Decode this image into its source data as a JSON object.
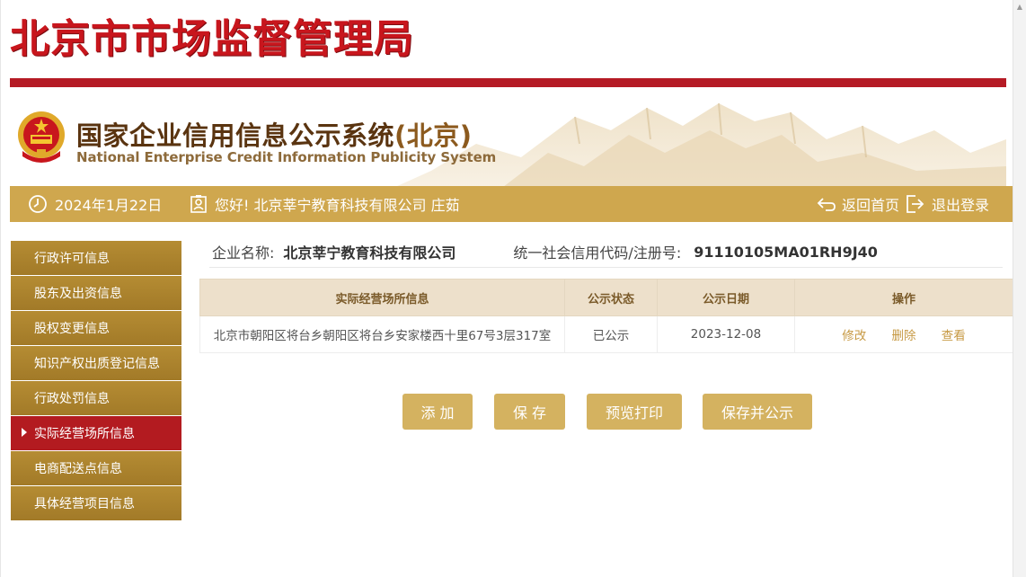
{
  "header": {
    "bureau_title": "北京市市场监督管理局",
    "system_title_cn": "国家企业信用信息公示系统",
    "system_title_region": "(北京)",
    "system_title_en": "National Enterprise Credit Information Publicity System"
  },
  "infobar": {
    "date": "2024年1月22日",
    "greeting": "您好! 北京莘宁教育科技有限公司  庄茹",
    "home_label": "返回首页",
    "logout_label": "退出登录"
  },
  "sidebar": {
    "items": [
      {
        "label": "行政许可信息",
        "active": false
      },
      {
        "label": "股东及出资信息",
        "active": false
      },
      {
        "label": "股权变更信息",
        "active": false
      },
      {
        "label": "知识产权出质登记信息",
        "active": false
      },
      {
        "label": "行政处罚信息",
        "active": false
      },
      {
        "label": "实际经营场所信息",
        "active": true
      },
      {
        "label": "电商配送点信息",
        "active": false
      },
      {
        "label": "具体经营项目信息",
        "active": false
      }
    ]
  },
  "company": {
    "name_label": "企业名称:",
    "name_value": "北京莘宁教育科技有限公司",
    "code_label": "统一社会信用代码/注册号:",
    "code_value": "91110105MA01RH9J40"
  },
  "table": {
    "headers": [
      "实际经营场所信息",
      "公示状态",
      "公示日期",
      "操作"
    ],
    "rows": [
      {
        "address": "北京市朝阳区将台乡朝阳区将台乡安家楼西十里67号3层317室",
        "status": "已公示",
        "date": "2023-12-08",
        "actions": [
          "修改",
          "删除",
          "查看"
        ]
      }
    ]
  },
  "buttons": {
    "add": "添 加",
    "save": "保 存",
    "preview": "预览打印",
    "save_publish": "保存并公示"
  },
  "colors": {
    "brand_red": "#c8161d",
    "gold": "#cfa74e",
    "sidebar_gold": "#a27a28",
    "active_red": "#b31b20"
  }
}
